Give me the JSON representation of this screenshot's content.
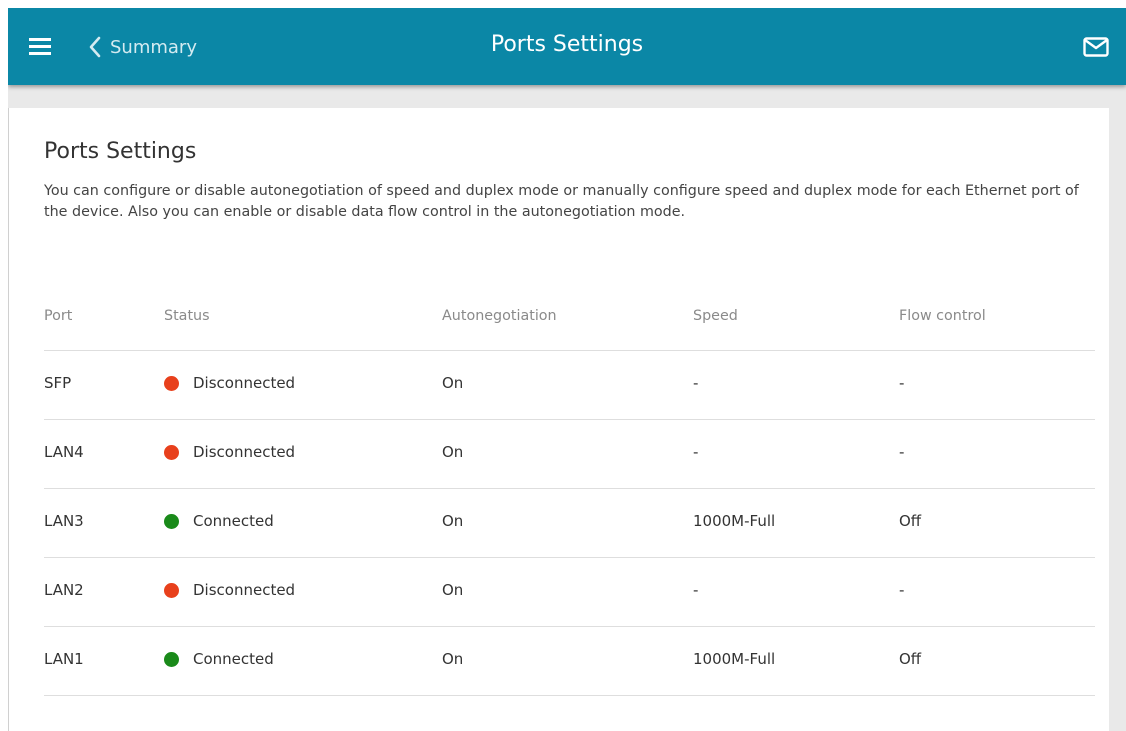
{
  "header": {
    "back_label": "Summary",
    "title": "Ports Settings",
    "icons": {
      "menu": "hamburger-menu-icon",
      "back": "chevron-left-icon",
      "mail": "envelope-icon"
    }
  },
  "main": {
    "title": "Ports Settings",
    "description": "You can configure or disable autonegotiation of speed and duplex mode or manually configure speed and duplex mode for each Ethernet port of the device. Also you can enable or disable data flow control in the autonegotiation mode."
  },
  "table": {
    "columns": [
      "Port",
      "Status",
      "Autonegotiation",
      "Speed",
      "Flow control"
    ],
    "rows": [
      {
        "port": "SFP",
        "status": "Disconnected",
        "autoneg": "On",
        "speed": "-",
        "flow": "-"
      },
      {
        "port": "LAN4",
        "status": "Disconnected",
        "autoneg": "On",
        "speed": "-",
        "flow": "-"
      },
      {
        "port": "LAN3",
        "status": "Connected",
        "autoneg": "On",
        "speed": "1000M-Full",
        "flow": "Off"
      },
      {
        "port": "LAN2",
        "status": "Disconnected",
        "autoneg": "On",
        "speed": "-",
        "flow": "-"
      },
      {
        "port": "LAN1",
        "status": "Connected",
        "autoneg": "On",
        "speed": "1000M-Full",
        "flow": "Off"
      }
    ]
  },
  "colors": {
    "header_bg": "#0b87a6",
    "connected": "#1a8a1a",
    "disconnected": "#e8401c"
  }
}
